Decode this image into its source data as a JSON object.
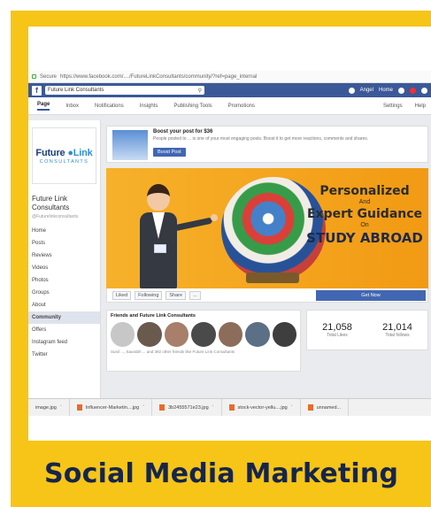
{
  "caption": "Social Media Marketing",
  "browser": {
    "secure_label": "Secure",
    "url": "https://www.facebook.com/..../FutureLinkConsultants/community/?ref=page_internal"
  },
  "fb_bar": {
    "search_value": "Future Link Consultants",
    "user_name": "Angel",
    "home_label": "Home"
  },
  "tabs": {
    "items": [
      "Page",
      "Inbox",
      "Notifications",
      "Insights",
      "Publishing Tools",
      "Promotions"
    ],
    "right": [
      "Settings",
      "Help"
    ]
  },
  "sidebar": {
    "logo_main_a": "Future",
    "logo_main_b": "Link",
    "logo_sub": "CONSULTANTS",
    "page_name": "Future Link Consultants",
    "page_handle": "@Futurelinkconsultants",
    "items": [
      "Home",
      "Posts",
      "Reviews",
      "Videos",
      "Photos",
      "Groups",
      "About",
      "Community",
      "Offers",
      "Instagram feed",
      "Twitter"
    ],
    "selected_index": 7
  },
  "boost": {
    "title": "Boost your post for $36",
    "text": "People posted to ... is one of your most engaging posts. Boost it to get more reactions, comments and shares.",
    "button": "Boost Post"
  },
  "cover": {
    "line1": "Personalized",
    "line2": "And",
    "line3": "Expert Guidance",
    "line4": "On",
    "line5": "STUDY ABROAD"
  },
  "actions": {
    "liked": "Liked",
    "following": "Following",
    "share": "Share",
    "more": "...",
    "get_now": "Get Now"
  },
  "friends": {
    "title": "Friends and Future Link Consultants",
    "note": "Sunil ..., Saurabh ... and 392 other friends like Future Link Consultants"
  },
  "stats": [
    {
      "num": "21,058",
      "label": "Total Likes"
    },
    {
      "num": "21,014",
      "label": "Total follows"
    }
  ],
  "downloads": [
    {
      "name": "image.jpg"
    },
    {
      "name": "Influencer-Marketin....jpg"
    },
    {
      "name": "3b2455571e23.jpg"
    },
    {
      "name": "stock-vector-yellu....jpg"
    },
    {
      "name": "unnamed..."
    }
  ],
  "colors": {
    "frame": "#f6c517",
    "caption_text": "#15254b",
    "facebook_blue": "#3b5998"
  }
}
